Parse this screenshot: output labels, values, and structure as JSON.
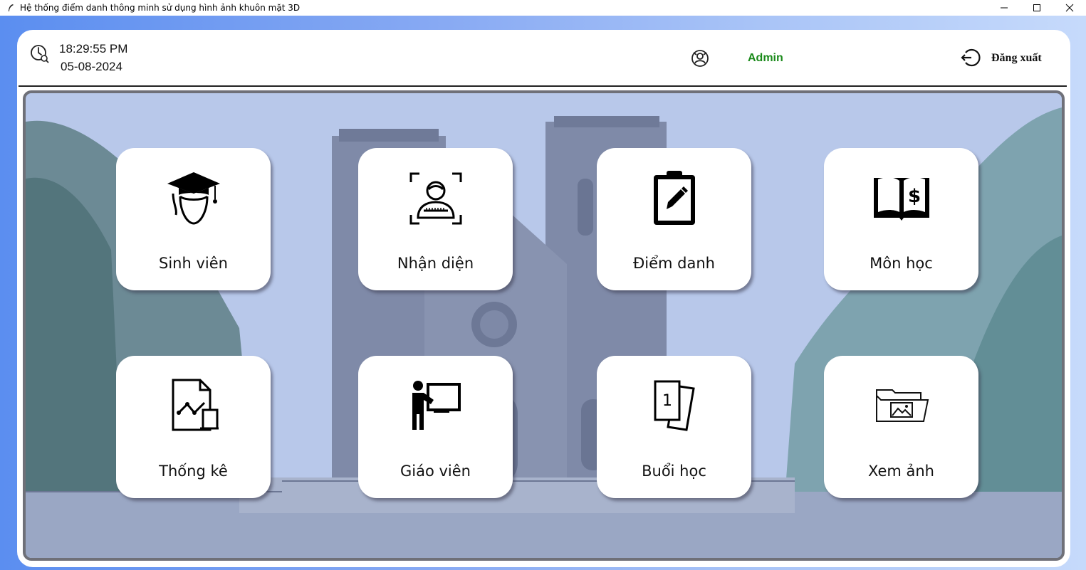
{
  "window": {
    "title": "Hệ thống điểm danh thông minh sử dụng hình ảnh khuôn mặt 3D"
  },
  "header": {
    "time": "18:29:55 PM",
    "date": "05-08-2024",
    "username": "Admin",
    "logout_label": "Đăng xuất"
  },
  "colors": {
    "username": "#1a8a1a",
    "backdrop_start": "#5b8ef0",
    "backdrop_end": "#c6dafb"
  },
  "menu": {
    "items": [
      {
        "label": "Sinh viên",
        "icon": "student-graduate-icon"
      },
      {
        "label": "Nhận diện",
        "icon": "face-scan-icon"
      },
      {
        "label": "Điểm danh",
        "icon": "clipboard-edit-icon"
      },
      {
        "label": "Môn học",
        "icon": "book-dollar-icon"
      },
      {
        "label": "Thống kê",
        "icon": "report-chart-icon"
      },
      {
        "label": "Giáo viên",
        "icon": "teacher-board-icon"
      },
      {
        "label": "Buổi học",
        "icon": "session-cards-icon"
      },
      {
        "label": "Xem ảnh",
        "icon": "image-folder-icon"
      }
    ]
  }
}
